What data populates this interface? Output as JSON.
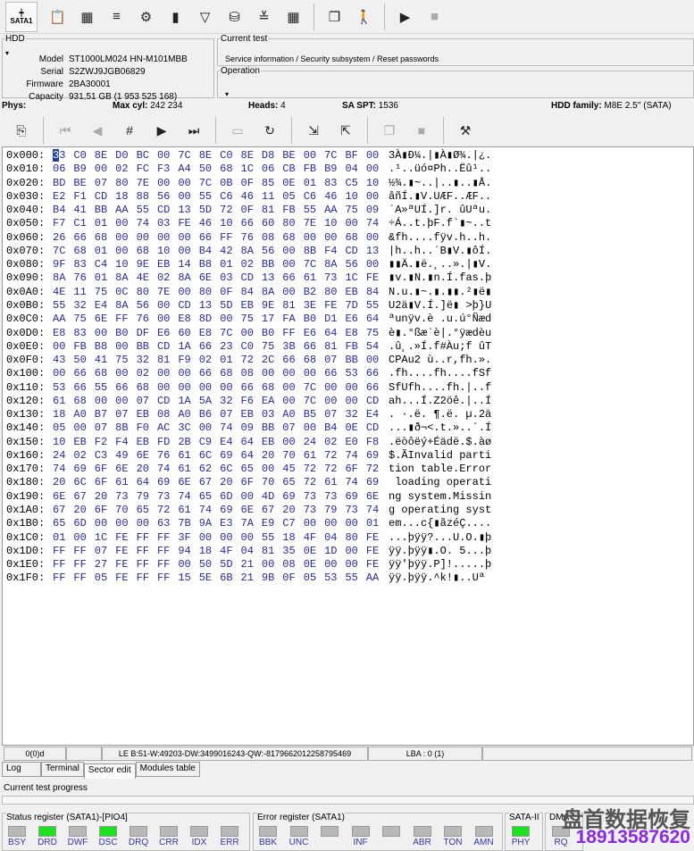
{
  "toolbar": {
    "port_label": "SATA1"
  },
  "hdd": {
    "legend": "HDD",
    "model_label": "Model",
    "model": "ST1000LM024 HN-M101MBB",
    "serial_label": "Serial",
    "serial": "S2ZWJ9JGB06829",
    "firmware_label": "Firmware",
    "firmware": "2BA30001",
    "capacity_label": "Capacity",
    "capacity": "931,51 GB (1 953 525 168)"
  },
  "current_test": {
    "legend": "Current test",
    "value": "Service information / Security subsystem / Reset passwords"
  },
  "operation": {
    "legend": "Operation",
    "value": ""
  },
  "phys": {
    "label": "Phys:",
    "maxcyl_label": "Max cyl:",
    "maxcyl": "242 234",
    "heads_label": "Heads:",
    "heads": "4",
    "saspt_label": "SA SPT:",
    "saspt": "1536",
    "family_label": "HDD family:",
    "family": "M8E 2.5'' (SATA)"
  },
  "hex_rows": [
    {
      "off": "0x000:",
      "bytes": [
        "33",
        "C0",
        "8E",
        "D0",
        "BC",
        "00",
        "7C",
        "8E",
        "C0",
        "8E",
        "D8",
        "BE",
        "00",
        "7C",
        "BF",
        "00"
      ],
      "ascii": "3À▮Ð¼.|▮À▮Ø¾.|¿."
    },
    {
      "off": "0x010:",
      "bytes": [
        "06",
        "B9",
        "00",
        "02",
        "FC",
        "F3",
        "A4",
        "50",
        "68",
        "1C",
        "06",
        "CB",
        "FB",
        "B9",
        "04",
        "00"
      ],
      "ascii": ".¹..üó¤Ph..Ëû¹.."
    },
    {
      "off": "0x020:",
      "bytes": [
        "BD",
        "BE",
        "07",
        "80",
        "7E",
        "00",
        "00",
        "7C",
        "0B",
        "0F",
        "85",
        "0E",
        "01",
        "83",
        "C5",
        "10"
      ],
      "ascii": "½¾.▮~..|..▮..▮Å."
    },
    {
      "off": "0x030:",
      "bytes": [
        "E2",
        "F1",
        "CD",
        "18",
        "88",
        "56",
        "00",
        "55",
        "C6",
        "46",
        "11",
        "05",
        "C6",
        "46",
        "10",
        "00"
      ],
      "ascii": "âñÍ.▮V.UÆF..ÆF.."
    },
    {
      "off": "0x040:",
      "bytes": [
        "B4",
        "41",
        "BB",
        "AA",
        "55",
        "CD",
        "13",
        "5D",
        "72",
        "0F",
        "81",
        "FB",
        "55",
        "AA",
        "75",
        "09"
      ],
      "ascii": "´A»ªUÍ.]r. ûUªu."
    },
    {
      "off": "0x050:",
      "bytes": [
        "F7",
        "C1",
        "01",
        "00",
        "74",
        "03",
        "FE",
        "46",
        "10",
        "66",
        "60",
        "80",
        "7E",
        "10",
        "00",
        "74"
      ],
      "ascii": "÷Á..t.þF.f`▮~..t"
    },
    {
      "off": "0x060:",
      "bytes": [
        "26",
        "66",
        "68",
        "00",
        "00",
        "00",
        "00",
        "66",
        "FF",
        "76",
        "08",
        "68",
        "00",
        "00",
        "68",
        "00"
      ],
      "ascii": "&fh....fÿv.h..h."
    },
    {
      "off": "0x070:",
      "bytes": [
        "7C",
        "68",
        "01",
        "00",
        "68",
        "10",
        "00",
        "B4",
        "42",
        "8A",
        "56",
        "00",
        "8B",
        "F4",
        "CD",
        "13"
      ],
      "ascii": "|h..h..´B▮V.▮ôÍ."
    },
    {
      "off": "0x080:",
      "bytes": [
        "9F",
        "83",
        "C4",
        "10",
        "9E",
        "EB",
        "14",
        "B8",
        "01",
        "02",
        "BB",
        "00",
        "7C",
        "8A",
        "56",
        "00"
      ],
      "ascii": "▮▮Ä.▮ë.¸..».|▮V."
    },
    {
      "off": "0x090:",
      "bytes": [
        "8A",
        "76",
        "01",
        "8A",
        "4E",
        "02",
        "8A",
        "6E",
        "03",
        "CD",
        "13",
        "66",
        "61",
        "73",
        "1C",
        "FE"
      ],
      "ascii": "▮v.▮N.▮n.Í.fas.þ"
    },
    {
      "off": "0x0A0:",
      "bytes": [
        "4E",
        "11",
        "75",
        "0C",
        "80",
        "7E",
        "00",
        "80",
        "0F",
        "84",
        "8A",
        "00",
        "B2",
        "80",
        "EB",
        "84"
      ],
      "ascii": "N.u.▮~.▮.▮▮.²▮ë▮"
    },
    {
      "off": "0x0B0:",
      "bytes": [
        "55",
        "32",
        "E4",
        "8A",
        "56",
        "00",
        "CD",
        "13",
        "5D",
        "EB",
        "9E",
        "81",
        "3E",
        "FE",
        "7D",
        "55"
      ],
      "ascii": "U2ä▮V.Í.]ë▮ >þ}U"
    },
    {
      "off": "0x0C0:",
      "bytes": [
        "AA",
        "75",
        "6E",
        "FF",
        "76",
        "00",
        "E8",
        "8D",
        "00",
        "75",
        "17",
        "FA",
        "B0",
        "D1",
        "E6",
        "64"
      ],
      "ascii": "ªunÿv.è .u.ú°Ñæd"
    },
    {
      "off": "0x0D0:",
      "bytes": [
        "E8",
        "83",
        "00",
        "B0",
        "DF",
        "E6",
        "60",
        "E8",
        "7C",
        "00",
        "B0",
        "FF",
        "E6",
        "64",
        "E8",
        "75"
      ],
      "ascii": "è▮.°ßæ`è|.°ÿædèu"
    },
    {
      "off": "0x0E0:",
      "bytes": [
        "00",
        "FB",
        "B8",
        "00",
        "BB",
        "CD",
        "1A",
        "66",
        "23",
        "C0",
        "75",
        "3B",
        "66",
        "81",
        "FB",
        "54"
      ],
      "ascii": ".û¸.»Í.f#Àu;f ûT"
    },
    {
      "off": "0x0F0:",
      "bytes": [
        "43",
        "50",
        "41",
        "75",
        "32",
        "81",
        "F9",
        "02",
        "01",
        "72",
        "2C",
        "66",
        "68",
        "07",
        "BB",
        "00"
      ],
      "ascii": "CPAu2 ù..r,fh.»."
    },
    {
      "off": "0x100:",
      "bytes": [
        "00",
        "66",
        "68",
        "00",
        "02",
        "00",
        "00",
        "66",
        "68",
        "08",
        "00",
        "00",
        "00",
        "66",
        "53",
        "66"
      ],
      "ascii": ".fh....fh....fSf"
    },
    {
      "off": "0x110:",
      "bytes": [
        "53",
        "66",
        "55",
        "66",
        "68",
        "00",
        "00",
        "00",
        "00",
        "66",
        "68",
        "00",
        "7C",
        "00",
        "00",
        "66"
      ],
      "ascii": "SfUfh....fh.|..f"
    },
    {
      "off": "0x120:",
      "bytes": [
        "61",
        "68",
        "00",
        "00",
        "07",
        "CD",
        "1A",
        "5A",
        "32",
        "F6",
        "EA",
        "00",
        "7C",
        "00",
        "00",
        "CD"
      ],
      "ascii": "ah...Í.Z2öê.|..Í"
    },
    {
      "off": "0x130:",
      "bytes": [
        "18",
        "A0",
        "B7",
        "07",
        "EB",
        "08",
        "A0",
        "B6",
        "07",
        "EB",
        "03",
        "A0",
        "B5",
        "07",
        "32",
        "E4"
      ],
      "ascii": ". ·.ë. ¶.ë. µ.2ä"
    },
    {
      "off": "0x140:",
      "bytes": [
        "05",
        "00",
        "07",
        "8B",
        "F0",
        "AC",
        "3C",
        "00",
        "74",
        "09",
        "BB",
        "07",
        "00",
        "B4",
        "0E",
        "CD"
      ],
      "ascii": "...▮ð¬<.t.»..´.Í"
    },
    {
      "off": "0x150:",
      "bytes": [
        "10",
        "EB",
        "F2",
        "F4",
        "EB",
        "FD",
        "2B",
        "C9",
        "E4",
        "64",
        "EB",
        "00",
        "24",
        "02",
        "E0",
        "F8"
      ],
      "ascii": ".ëòôëý+Éädë.$.àø"
    },
    {
      "off": "0x160:",
      "bytes": [
        "24",
        "02",
        "C3",
        "49",
        "6E",
        "76",
        "61",
        "6C",
        "69",
        "64",
        "20",
        "70",
        "61",
        "72",
        "74",
        "69"
      ],
      "ascii": "$.ÃInvalid parti"
    },
    {
      "off": "0x170:",
      "bytes": [
        "74",
        "69",
        "6F",
        "6E",
        "20",
        "74",
        "61",
        "62",
        "6C",
        "65",
        "00",
        "45",
        "72",
        "72",
        "6F",
        "72"
      ],
      "ascii": "tion table.Error"
    },
    {
      "off": "0x180:",
      "bytes": [
        "20",
        "6C",
        "6F",
        "61",
        "64",
        "69",
        "6E",
        "67",
        "20",
        "6F",
        "70",
        "65",
        "72",
        "61",
        "74",
        "69"
      ],
      "ascii": " loading operati"
    },
    {
      "off": "0x190:",
      "bytes": [
        "6E",
        "67",
        "20",
        "73",
        "79",
        "73",
        "74",
        "65",
        "6D",
        "00",
        "4D",
        "69",
        "73",
        "73",
        "69",
        "6E"
      ],
      "ascii": "ng system.Missin"
    },
    {
      "off": "0x1A0:",
      "bytes": [
        "67",
        "20",
        "6F",
        "70",
        "65",
        "72",
        "61",
        "74",
        "69",
        "6E",
        "67",
        "20",
        "73",
        "79",
        "73",
        "74"
      ],
      "ascii": "g operating syst"
    },
    {
      "off": "0x1B0:",
      "bytes": [
        "65",
        "6D",
        "00",
        "00",
        "00",
        "63",
        "7B",
        "9A",
        "E3",
        "7A",
        "E9",
        "C7",
        "00",
        "00",
        "00",
        "01"
      ],
      "ascii": "em...c{▮ãzéÇ...."
    },
    {
      "off": "0x1C0:",
      "bytes": [
        "01",
        "00",
        "1C",
        "FE",
        "FF",
        "FF",
        "3F",
        "00",
        "00",
        "00",
        "55",
        "18",
        "4F",
        "04",
        "80",
        "FE"
      ],
      "ascii": "...þÿÿ?...U.O.▮þ"
    },
    {
      "off": "0x1D0:",
      "bytes": [
        "FF",
        "FF",
        "07",
        "FE",
        "FF",
        "FF",
        "94",
        "18",
        "4F",
        "04",
        "81",
        "35",
        "0E",
        "1D",
        "00",
        "FE"
      ],
      "ascii": "ÿÿ.þÿÿ▮.O. 5...þ"
    },
    {
      "off": "0x1E0:",
      "bytes": [
        "FF",
        "FF",
        "27",
        "FE",
        "FF",
        "FF",
        "00",
        "50",
        "5D",
        "21",
        "00",
        "08",
        "0E",
        "00",
        "00",
        "FE"
      ],
      "ascii": "ÿÿ'þÿÿ.P]!.....þ"
    },
    {
      "off": "0x1F0:",
      "bytes": [
        "FF",
        "FF",
        "05",
        "FE",
        "FF",
        "FF",
        "15",
        "5E",
        "6B",
        "21",
        "9B",
        "0F",
        "05",
        "53",
        "55",
        "AA"
      ],
      "ascii": "ÿÿ.þÿÿ.^k!▮..Uª"
    }
  ],
  "statusbar": {
    "pos": "0(0)d",
    "blank": "",
    "le": "LE B:51-W:49203-DW:3499016243-QW:-8179662012258795469",
    "lba": "LBA : 0 (1)"
  },
  "tabs": [
    {
      "label": "Log"
    },
    {
      "label": "Terminal"
    },
    {
      "label": "Sector edit",
      "active": true
    },
    {
      "label": "Modules table"
    }
  ],
  "progress": {
    "label": "Current test progress",
    "value": 0
  },
  "status_register": {
    "title": "Status register (SATA1)-[PIO4]",
    "leds": [
      {
        "label": "BSY",
        "on": false
      },
      {
        "label": "DRD",
        "on": true
      },
      {
        "label": "DWF",
        "on": false
      },
      {
        "label": "DSC",
        "on": true
      },
      {
        "label": "DRQ",
        "on": false
      },
      {
        "label": "CRR",
        "on": false
      },
      {
        "label": "IDX",
        "on": false
      },
      {
        "label": "ERR",
        "on": false
      }
    ]
  },
  "error_register": {
    "title": "Error register (SATA1)",
    "leds": [
      {
        "label": "BBK",
        "on": false
      },
      {
        "label": "UNC",
        "on": false
      },
      {
        "label": "",
        "on": false
      },
      {
        "label": "INF",
        "on": false
      },
      {
        "label": "",
        "on": false
      },
      {
        "label": "ABR",
        "on": false
      },
      {
        "label": "TON",
        "on": false
      },
      {
        "label": "AMN",
        "on": false
      }
    ]
  },
  "sata2": {
    "title": "SATA-II",
    "leds": [
      {
        "label": "PHY",
        "on": true
      }
    ]
  },
  "dma": {
    "title": "DMA",
    "leds": [
      {
        "label": "RQ",
        "on": false
      }
    ]
  },
  "watermark": {
    "name": "盘首数据恢复",
    "phone": "18913587620"
  },
  "colors": {
    "hex_bytes": "#2a2aa0",
    "led_on": "#1fe01f",
    "led_off": "#b8b8b8",
    "watermark_name": "#555555",
    "watermark_phone": "#8a2be2"
  }
}
